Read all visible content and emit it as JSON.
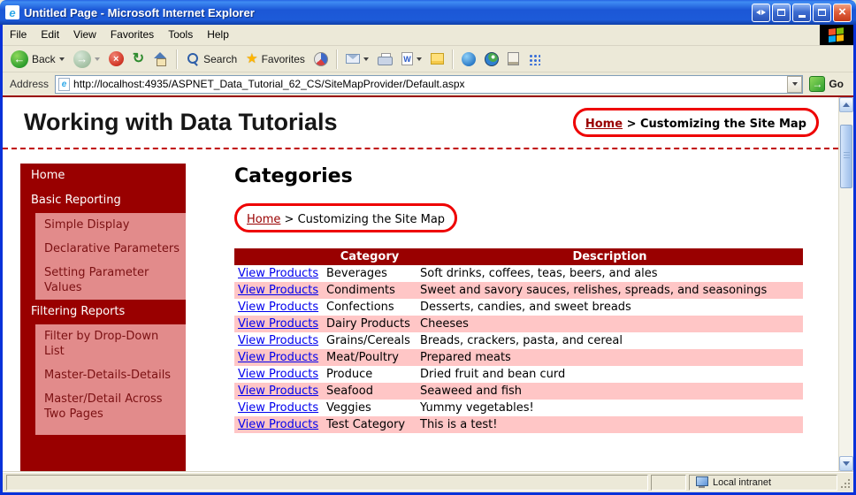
{
  "window": {
    "title": "Untitled Page - Microsoft Internet Explorer"
  },
  "menu": {
    "items": [
      "File",
      "Edit",
      "View",
      "Favorites",
      "Tools",
      "Help"
    ]
  },
  "toolbar": {
    "back": "Back",
    "search": "Search",
    "favorites": "Favorites"
  },
  "address": {
    "label": "Address",
    "url": "http://localhost:4935/ASPNET_Data_Tutorial_62_CS/SiteMapProvider/Default.aspx",
    "go": "Go"
  },
  "page": {
    "title": "Working with Data Tutorials",
    "breadcrumb": {
      "home": "Home",
      "separator": ">",
      "current": "Customizing the Site Map"
    },
    "sidebar": {
      "items": [
        "Home",
        "Basic Reporting",
        "Simple Display",
        "Declarative Parameters",
        "Setting Parameter Values",
        "Filtering Reports",
        "Filter by Drop-Down List",
        "Master-Details-Details",
        "Master/Detail Across Two Pages"
      ]
    },
    "main": {
      "heading": "Categories",
      "table": {
        "headers": [
          "",
          "Category",
          "Description"
        ],
        "link": "View Products",
        "rows": [
          {
            "category": "Beverages",
            "description": "Soft drinks, coffees, teas, beers, and ales"
          },
          {
            "category": "Condiments",
            "description": "Sweet and savory sauces, relishes, spreads, and seasonings"
          },
          {
            "category": "Confections",
            "description": "Desserts, candies, and sweet breads"
          },
          {
            "category": "Dairy Products",
            "description": "Cheeses"
          },
          {
            "category": "Grains/Cereals",
            "description": "Breads, crackers, pasta, and cereal"
          },
          {
            "category": "Meat/Poultry",
            "description": "Prepared meats"
          },
          {
            "category": "Produce",
            "description": "Dried fruit and bean curd"
          },
          {
            "category": "Seafood",
            "description": "Seaweed and fish"
          },
          {
            "category": "Veggies",
            "description": "Yummy vegetables!"
          },
          {
            "category": "Test Category",
            "description": "This is a test!"
          }
        ]
      }
    }
  },
  "status": {
    "zone": "Local intranet"
  },
  "colors": {
    "maroon": "#990000",
    "sidebar_child_bg": "#E28B8B",
    "sidebar_child_text": "#7B1113",
    "table_alt_row": "#FFC6C6",
    "link_blue": "#0000EE",
    "breadcrumb_link": "#990000",
    "annotation_red": "#EE0000",
    "titlebar_blue": "#1C54D0"
  }
}
